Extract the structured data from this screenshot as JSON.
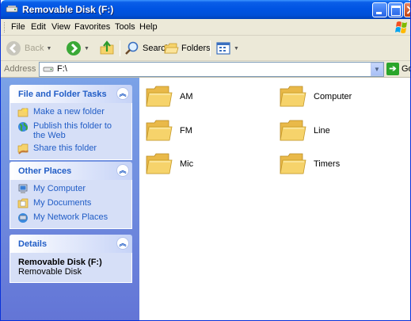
{
  "window": {
    "title": "Removable Disk (F:)"
  },
  "menubar": {
    "items": [
      "File",
      "Edit",
      "View",
      "Favorites",
      "Tools",
      "Help"
    ]
  },
  "toolbar": {
    "back_label": "Back",
    "search_label": "Search",
    "folders_label": "Folders"
  },
  "address": {
    "label": "Address",
    "value": "F:\\",
    "go_label": "Go"
  },
  "panels": {
    "file_tasks": {
      "title": "File and Folder Tasks",
      "items": [
        "Make a new folder",
        "Publish this folder to the Web",
        "Share this folder"
      ]
    },
    "other_places": {
      "title": "Other Places",
      "items": [
        "My Computer",
        "My Documents",
        "My Network Places"
      ]
    },
    "details": {
      "title": "Details",
      "name": "Removable Disk (F:)",
      "type": "Removable Disk"
    }
  },
  "folders": [
    "AM",
    "Computer",
    "FM",
    "Line",
    "Mic",
    "Timers"
  ],
  "colors": {
    "titlebar": "#0054e3",
    "taskpane_bg": "#7ba2e7",
    "link": "#215dc6",
    "folder": "#f6d36b"
  }
}
